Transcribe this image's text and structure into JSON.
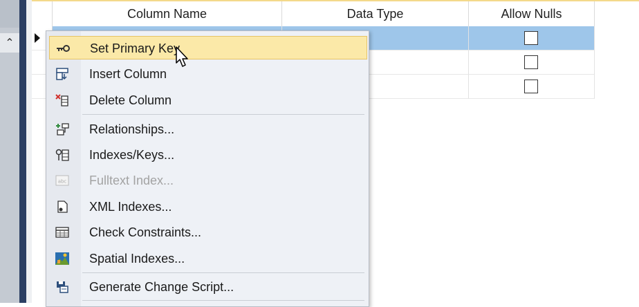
{
  "grid": {
    "columns": [
      {
        "label": "Column Name"
      },
      {
        "label": "Data Type"
      },
      {
        "label": "Allow Nulls"
      }
    ],
    "rows": [
      {
        "selected": true,
        "allow_nulls": false
      },
      {
        "selected": false,
        "allow_nulls": false
      },
      {
        "selected": false,
        "allow_nulls": false
      }
    ]
  },
  "context_menu": {
    "items": [
      {
        "label": "Set Primary Key",
        "icon": "key-icon",
        "highlighted": true
      },
      {
        "label": "Insert Column",
        "icon": "insert-column-icon"
      },
      {
        "label": "Delete Column",
        "icon": "delete-column-icon"
      },
      {
        "label": "Relationships...",
        "icon": "relationships-icon"
      },
      {
        "label": "Indexes/Keys...",
        "icon": "indexes-keys-icon"
      },
      {
        "label": "Fulltext Index...",
        "icon": "fulltext-icon",
        "disabled": true
      },
      {
        "label": "XML Indexes...",
        "icon": "xml-index-icon"
      },
      {
        "label": "Check Constraints...",
        "icon": "check-constraints-icon"
      },
      {
        "label": "Spatial Indexes...",
        "icon": "spatial-index-icon"
      },
      {
        "label": "Generate Change Script...",
        "icon": "change-script-icon"
      }
    ]
  },
  "colors": {
    "selected_row": "#9ec6ea",
    "menu_highlight": "#fbe9a8",
    "sidebar_dark": "#2b3f63"
  }
}
